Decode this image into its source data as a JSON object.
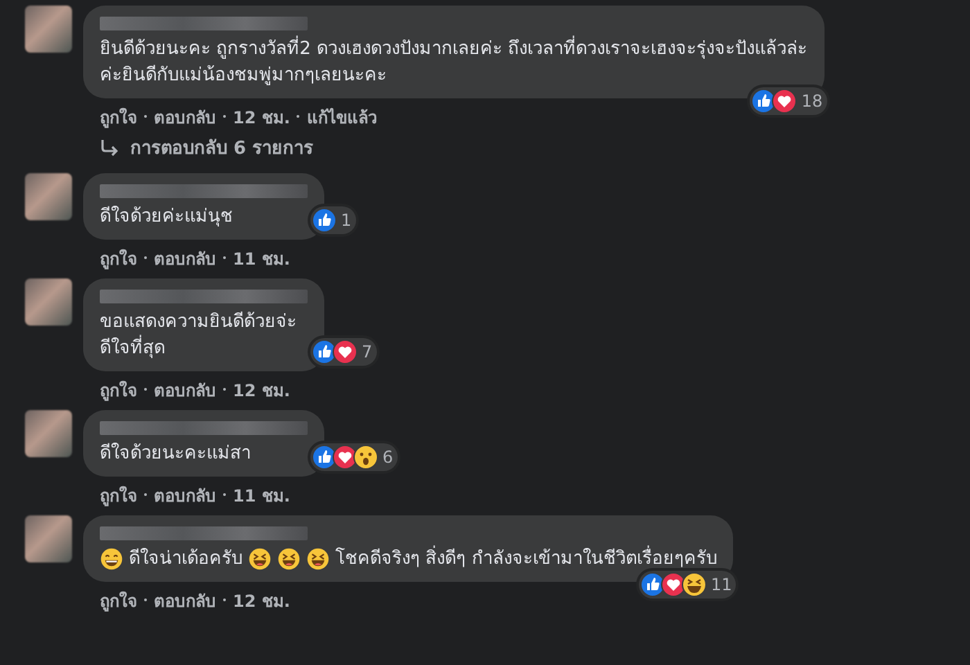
{
  "comments": [
    {
      "lines": [
        "ยินดีด้วยนะคะ ถูกรางวัลที่2 ดวงเฮงดวงปังมากเลยค่ะ ถึงเวลาที่ดวงเราจะเฮงจะรุ่งจะปังแล้วล่ะ",
        "ค่ะยินดีกับแม่น้องชมพู่มากๆเลยนะคะ"
      ],
      "reactions": [
        {
          "kind": "like"
        },
        {
          "kind": "love"
        }
      ],
      "reaction_count": "18",
      "reactions_inside": true,
      "actions": [
        "ถูกใจ",
        "ตอบกลับ",
        "12 ชม.",
        "แก้ไขแล้ว"
      ],
      "replies": "การตอบกลับ 6 รายการ"
    },
    {
      "lines": [
        "ดีใจด้วยค่ะแม่นุช"
      ],
      "reactions": [
        {
          "kind": "like"
        }
      ],
      "reaction_count": "1",
      "reactions_inside": false,
      "actions": [
        "ถูกใจ",
        "ตอบกลับ",
        "11 ชม."
      ]
    },
    {
      "lines": [
        "ขอแสดงความยินดีด้วยจ่ะ",
        "ดีใจที่สุด"
      ],
      "reactions": [
        {
          "kind": "like"
        },
        {
          "kind": "love"
        }
      ],
      "reaction_count": "7",
      "reactions_inside": false,
      "actions": [
        "ถูกใจ",
        "ตอบกลับ",
        "12 ชม."
      ]
    },
    {
      "lines": [
        "ดีใจด้วยนะคะแม่สา"
      ],
      "reactions": [
        {
          "kind": "like"
        },
        {
          "kind": "love"
        },
        {
          "kind": "wow"
        }
      ],
      "reaction_count": "6",
      "reactions_inside": false,
      "actions": [
        "ถูกใจ",
        "ตอบกลับ",
        "11 ชม."
      ]
    },
    {
      "parts": [
        {
          "kind": "grin"
        },
        {
          "kind": "text",
          "text": "ดีใจน่าเด้อครับ"
        },
        {
          "kind": "laugh"
        },
        {
          "kind": "laugh"
        },
        {
          "kind": "laugh"
        },
        {
          "kind": "text",
          "text": "โชคดีจริงๆ สิ่งดีๆ กำลังจะเข้ามาในชีวิตเรื่อยๆครับ"
        }
      ],
      "reactions": [
        {
          "kind": "like"
        },
        {
          "kind": "love"
        },
        {
          "kind": "haha"
        }
      ],
      "reaction_count": "11",
      "reactions_inside": true,
      "actions": [
        "ถูกใจ",
        "ตอบกลับ",
        "12 ชม."
      ]
    }
  ]
}
